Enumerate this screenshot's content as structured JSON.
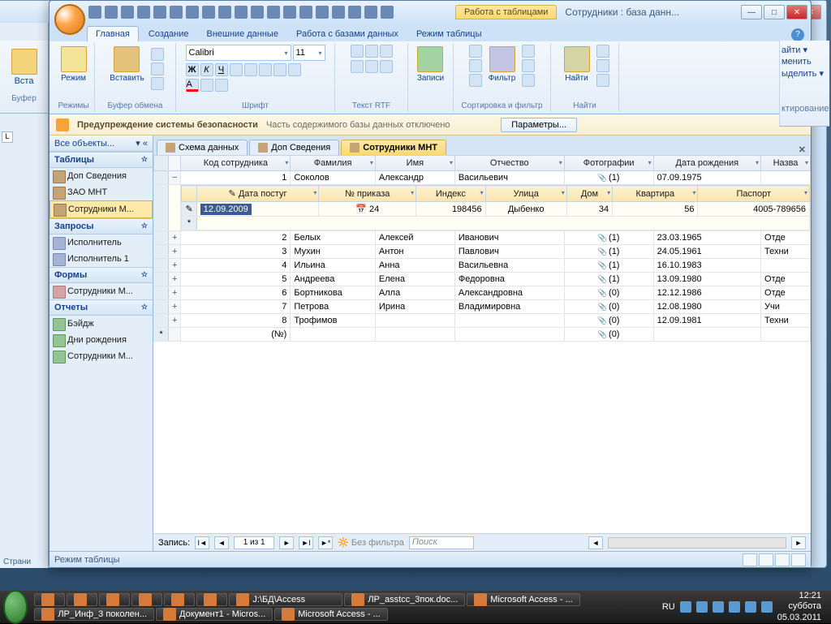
{
  "window": {
    "context_tab": "Работа с таблицами",
    "title": "Сотрудники : база данн..."
  },
  "ribbon_tabs": [
    "Главная",
    "Создание",
    "Внешние данные",
    "Работа с базами данных",
    "Режим таблицы"
  ],
  "ribbon": {
    "view": "Режим",
    "views_group": "Режимы",
    "paste": "Вставить",
    "clipboard_group": "Буфер обмена",
    "font_name": "Calibri",
    "font_size": "11",
    "font_group": "Шрифт",
    "rtf_group": "Текст RTF",
    "records": "Записи",
    "records_group": "",
    "filter": "Фильтр",
    "sort_group": "Сортировка и фильтр",
    "find": "Найти",
    "find_group": "Найти"
  },
  "bg_ribbon": {
    "paste": "Вста",
    "clip": "Буфер",
    "find1": "айти ▾",
    "find2": "менить",
    "find3": "ыделить ▾",
    "find_group": "ктирование",
    "page": "Страни"
  },
  "security": {
    "label": "Предупреждение системы безопасности",
    "desc": "Часть содержимого базы данных отключено",
    "button": "Параметры..."
  },
  "nav": {
    "header": "Все объекты...",
    "groups": [
      {
        "name": "Таблицы",
        "items": [
          "Доп Сведения",
          "ЗАО МНТ",
          "Сотрудники М..."
        ],
        "type": "table",
        "selected": 2
      },
      {
        "name": "Запросы",
        "items": [
          "Исполнитель",
          "Исполнитель 1"
        ],
        "type": "query"
      },
      {
        "name": "Формы",
        "items": [
          "Сотрудники М..."
        ],
        "type": "form"
      },
      {
        "name": "Отчеты",
        "items": [
          "Бэйдж",
          "Дни рождения",
          "Сотрудники М..."
        ],
        "type": "report"
      }
    ]
  },
  "tabs": [
    {
      "label": "Схема данных",
      "active": false
    },
    {
      "label": "Доп Сведения",
      "active": false
    },
    {
      "label": "Сотрудники МНТ",
      "active": true
    }
  ],
  "columns": [
    "Код сотрудника",
    "Фамилия",
    "Имя",
    "Отчество",
    "Фотографии",
    "Дата рождения",
    "Назва"
  ],
  "sub_columns": [
    "Дата постуг",
    "№ приказа",
    "Индекс",
    "Улица",
    "Дом",
    "Квартира",
    "Паспорт"
  ],
  "rows": [
    {
      "id": "1",
      "fam": "Соколов",
      "name": "Александр",
      "otch": "Васильевич",
      "photo": "(1)",
      "dob": "07.09.1975",
      "extra": "",
      "expanded": true,
      "sub": {
        "date": "12.09.2009",
        "prikaz": "24",
        "index": "198456",
        "street": "Дыбенко",
        "dom": "34",
        "kv": "56",
        "passport": "4005-789656"
      }
    },
    {
      "id": "2",
      "fam": "Белых",
      "name": "Алексей",
      "otch": "Иванович",
      "photo": "(1)",
      "dob": "23.03.1965",
      "extra": "Отде"
    },
    {
      "id": "3",
      "fam": "Мухин",
      "name": "Антон",
      "otch": "Павлович",
      "photo": "(1)",
      "dob": "24.05.1961",
      "extra": "Техни"
    },
    {
      "id": "4",
      "fam": "Ильина",
      "name": "Анна",
      "otch": "Васильевна",
      "photo": "(1)",
      "dob": "16.10.1983",
      "extra": ""
    },
    {
      "id": "5",
      "fam": "Андреева",
      "name": "Елена",
      "otch": "Федоровна",
      "photo": "(1)",
      "dob": "13.09.1980",
      "extra": "Отде"
    },
    {
      "id": "6",
      "fam": "Бортникова",
      "name": "Алла",
      "otch": "Александровна",
      "photo": "(0)",
      "dob": "12.12.1986",
      "extra": "Отде"
    },
    {
      "id": "7",
      "fam": "Петрова",
      "name": "Ирина",
      "otch": "Владимировна",
      "photo": "(0)",
      "dob": "12.08.1980",
      "extra": "Учи"
    },
    {
      "id": "8",
      "fam": "Трофимов",
      "name": "",
      "otch": "",
      "photo": "(0)",
      "dob": "12.09.1981",
      "extra": "Техни"
    }
  ],
  "new_row": {
    "id": "(№)",
    "photo": "(0)"
  },
  "record_nav": {
    "label": "Запись:",
    "pos": "1 из 1",
    "filter": "Без фильтра",
    "search": "Поиск"
  },
  "status": "Режим таблицы",
  "taskbar": {
    "items": [
      "",
      "",
      "",
      "",
      "",
      "",
      "J:\\БД\\Access",
      "ЛР_asstcc_3пок.doc...",
      "Microsoft Access - ...",
      "ЛР_Инф_3 поколен...",
      "Документ1 - Micros...",
      "Microsoft Access - ..."
    ],
    "lang": "RU",
    "time": "12:21",
    "day": "суббота",
    "date": "05.03.2011"
  }
}
